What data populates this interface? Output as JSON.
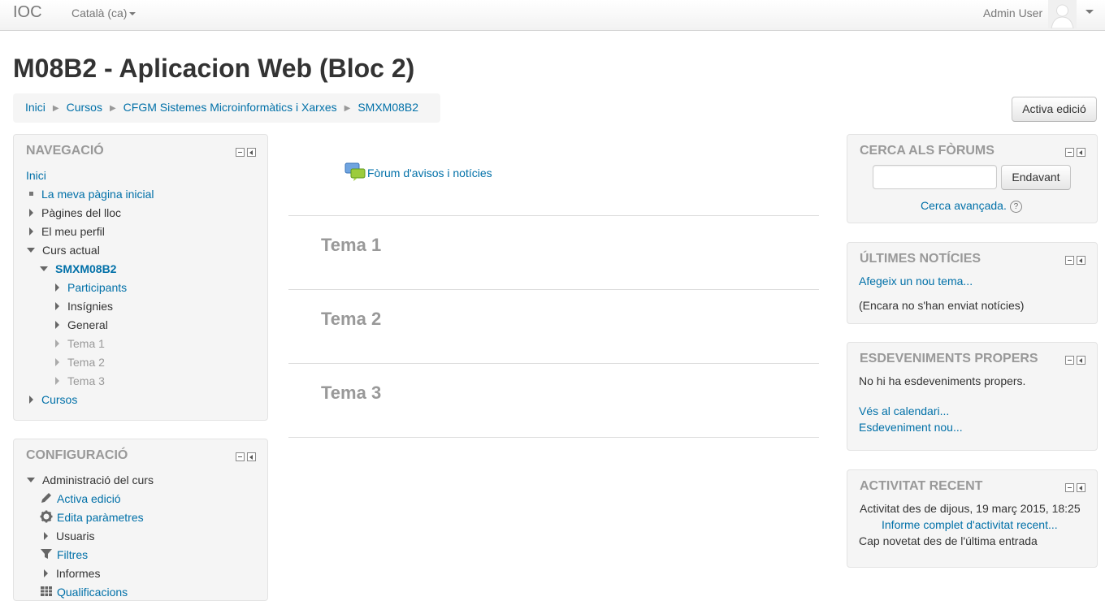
{
  "navbar": {
    "brand": "IOC",
    "language": "Català (ca)",
    "user_name": "Admin User"
  },
  "page_title": "M08B2 - Aplicacion Web (Bloc 2)",
  "breadcrumb": [
    "Inici",
    "Cursos",
    "CFGM Sistemes Microinformàtics i Xarxes",
    "SMXM08B2"
  ],
  "edit_button": "Activa edició",
  "navigation": {
    "title": "Navegació",
    "items": [
      {
        "label": "Inici"
      },
      {
        "label": "La meva pàgina inicial"
      },
      {
        "label": "Pàgines del lloc"
      },
      {
        "label": "El meu perfil"
      },
      {
        "label": "Curs actual"
      },
      {
        "label": "SMXM08B2"
      },
      {
        "label": "Participants"
      },
      {
        "label": "Insígnies"
      },
      {
        "label": "General"
      },
      {
        "label": "Tema 1"
      },
      {
        "label": "Tema 2"
      },
      {
        "label": "Tema 3"
      },
      {
        "label": "Cursos"
      }
    ]
  },
  "settings": {
    "title": "Configuració",
    "items": [
      {
        "label": "Administració del curs"
      },
      {
        "label": "Activa edició"
      },
      {
        "label": "Edita paràmetres"
      },
      {
        "label": "Usuaris"
      },
      {
        "label": "Filtres"
      },
      {
        "label": "Informes"
      },
      {
        "label": "Qualificacions"
      }
    ]
  },
  "main": {
    "forum_link": "Fòrum d'avisos i notícies",
    "sections": [
      "Tema 1",
      "Tema 2",
      "Tema 3"
    ]
  },
  "search_forums": {
    "title": "Cerca als fòrums",
    "input_value": "",
    "button": "Endavant",
    "advanced": "Cerca avançada."
  },
  "latest_news": {
    "title": "Últimes notícies",
    "add_topic": "Afegeix un nou tema...",
    "empty": "(Encara no s'han enviat notícies)"
  },
  "upcoming_events": {
    "title": "Esdeveniments propers",
    "empty": "No hi ha esdeveniments propers.",
    "calendar_link": "Vés al calendari...",
    "new_event_link": "Esdeveniment nou..."
  },
  "recent_activity": {
    "title": "Activitat recent",
    "since": "Activitat des de dijous, 19 març 2015, 18:25",
    "full_report": "Informe complet d'activitat recent...",
    "none": "Cap novetat des de l'última entrada"
  },
  "colors": {
    "link": "#0070a8",
    "block_bg": "#f5f5f5",
    "muted": "#999999"
  }
}
